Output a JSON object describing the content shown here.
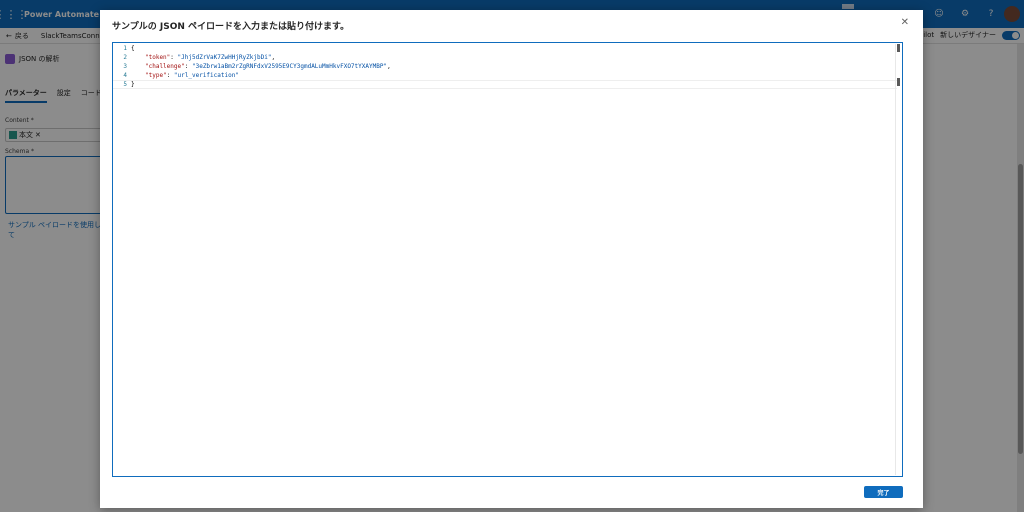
{
  "app": {
    "title": "Power Automate"
  },
  "commandbar": {
    "back_label": "戻る",
    "flow_name": "SlackTeamsConnect",
    "copilot_label": "ilot",
    "new_designer_label": "新しいデザイナー"
  },
  "panel": {
    "action_title": "JSON の解析",
    "tabs": [
      "パラメーター",
      "設定",
      "コード"
    ],
    "content_label": "Content *",
    "content_token": "本文",
    "schema_label": "Schema *",
    "sample_link": "サンプル ペイロードを使用して"
  },
  "dialog": {
    "title": "サンプルの JSON ペイロードを入力または貼り付けます。",
    "done_label": "完了",
    "editor": {
      "line_numbers": [
        "1",
        "2",
        "3",
        "4",
        "5"
      ],
      "open_brace": "{",
      "close_brace": "}",
      "token_key": "\"token\"",
      "token_value": "\"Jhj5dZrVaK7ZwHHjRyZkjbDi\"",
      "challenge_key": "\"challenge\"",
      "challenge_value": "\"3eZbrw1aBm2rZgRNFdxV2595E9CY3gmdALuMmHkvFXO7tYXAYMBP\"",
      "type_key": "\"type\"",
      "type_value": "\"url_verification\""
    }
  },
  "colors": {
    "brand": "#0f6cbd",
    "json_key": "#a31515",
    "json_string": "#0451a5"
  }
}
